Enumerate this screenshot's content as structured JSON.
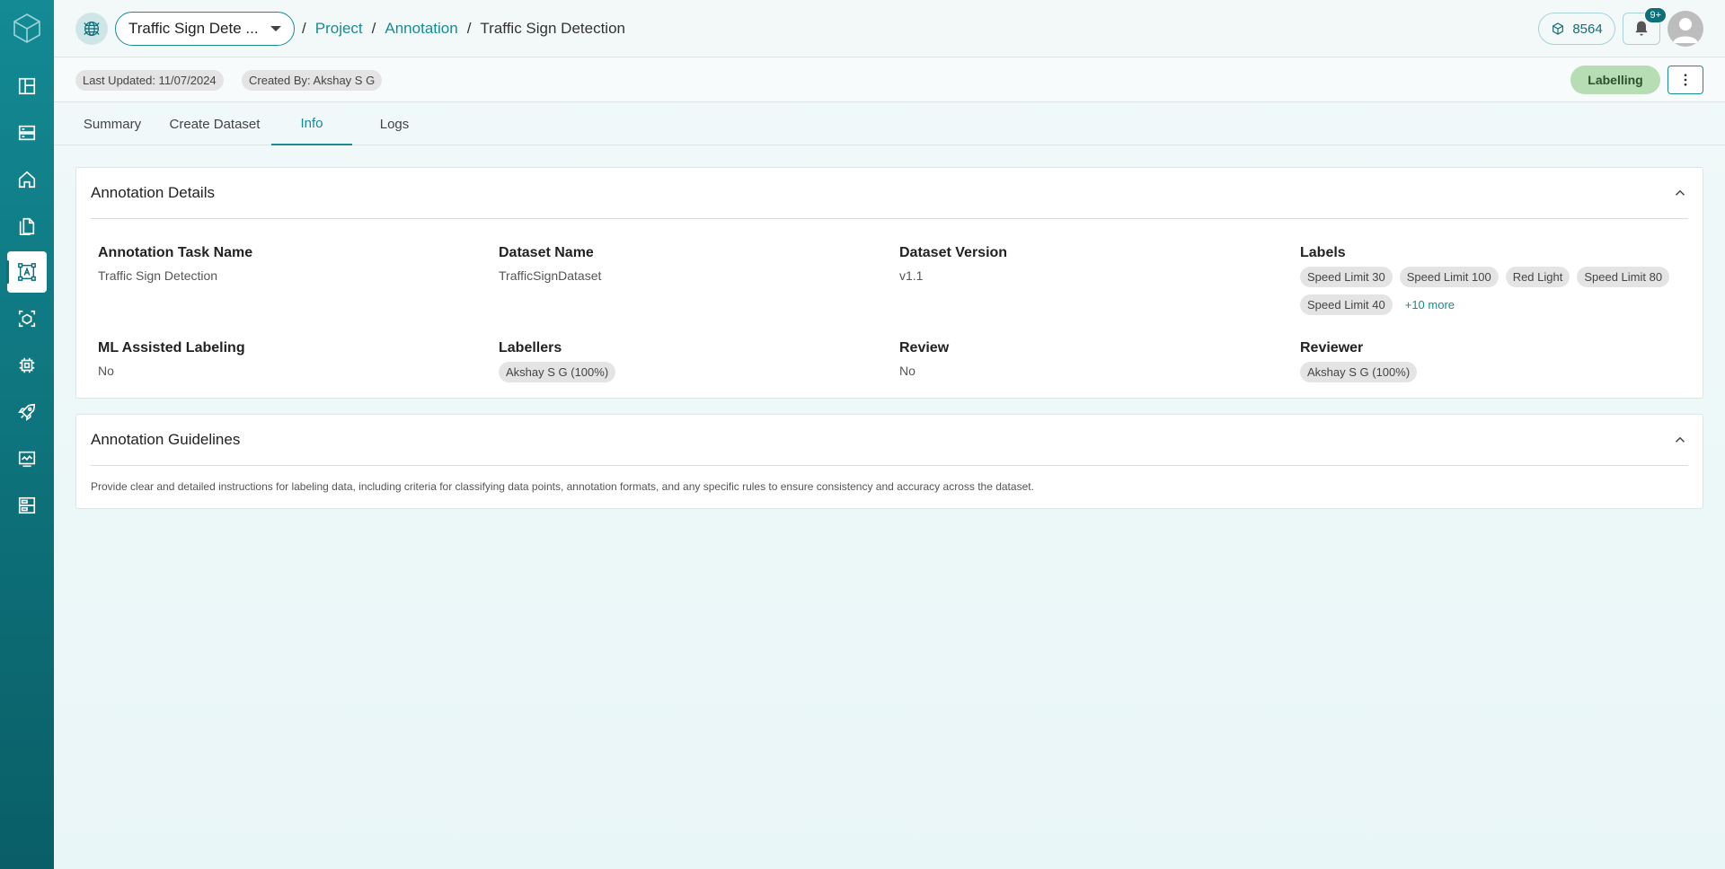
{
  "sidebar": {
    "items": [
      {
        "icon": "dashboard-icon"
      },
      {
        "icon": "server-icon"
      },
      {
        "icon": "home-icon"
      },
      {
        "icon": "documents-icon"
      },
      {
        "icon": "annotation-icon",
        "active": true
      },
      {
        "icon": "model-cube-icon"
      },
      {
        "icon": "chip-icon"
      },
      {
        "icon": "rocket-icon"
      },
      {
        "icon": "monitor-icon"
      },
      {
        "icon": "storage-icon"
      }
    ]
  },
  "header": {
    "project_select": "Traffic Sign Dete ...",
    "breadcrumb": {
      "sep": "/",
      "project": "Project",
      "annotation": "Annotation",
      "current": "Traffic Sign Detection"
    },
    "credits": "8564",
    "notifications_badge": "9+"
  },
  "subheader": {
    "last_updated": "Last Updated: 11/07/2024",
    "created_by": "Created By: Akshay S G",
    "status": "Labelling"
  },
  "tabs": [
    "Summary",
    "Create Dataset",
    "Info",
    "Logs"
  ],
  "active_tab": "Info",
  "annotation_details": {
    "title": "Annotation Details",
    "task_name_label": "Annotation Task Name",
    "task_name": "Traffic Sign Detection",
    "dataset_name_label": "Dataset Name",
    "dataset_name": "TrafficSignDataset",
    "dataset_version_label": "Dataset Version",
    "dataset_version": "v1.1",
    "labels_label": "Labels",
    "labels": [
      "Speed Limit 30",
      "Speed Limit 100",
      "Red Light",
      "Speed Limit 80",
      "Speed Limit 40"
    ],
    "labels_more": "+10 more",
    "ml_label": "ML Assisted Labeling",
    "ml_value": "No",
    "labellers_label": "Labellers",
    "labellers": [
      "Akshay S G (100%)"
    ],
    "review_label": "Review",
    "review_value": "No",
    "reviewer_label": "Reviewer",
    "reviewers": [
      "Akshay S G (100%)"
    ]
  },
  "annotation_guidelines": {
    "title": "Annotation Guidelines",
    "text": "Provide clear and detailed instructions for labeling data, including criteria for classifying data points, annotation formats, and any specific rules to ensure consistency and accuracy across the dataset."
  },
  "colors": {
    "accent": "#1a8a94",
    "sidebar": "#0d6f78",
    "status": "#b6ddb4"
  }
}
